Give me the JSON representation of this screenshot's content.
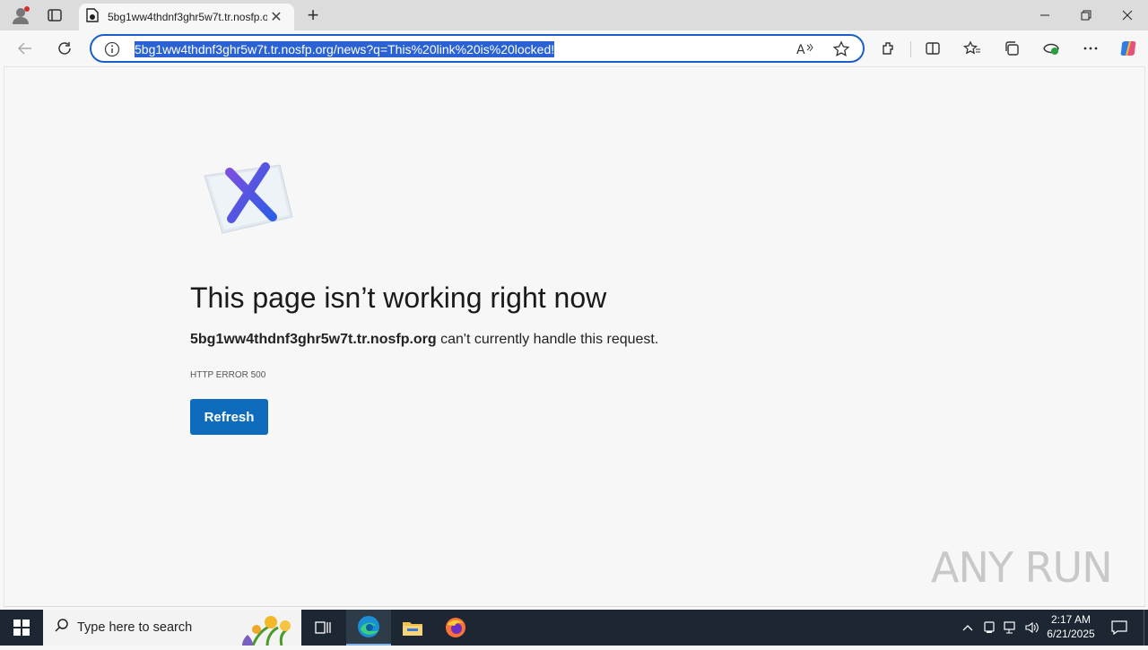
{
  "browser": {
    "tab_title": "5bg1ww4thdnf3ghr5w7t.tr.nosfp.org",
    "tab_close": "✕",
    "new_tab": "+",
    "url": "5bg1ww4thdnf3ghr5w7t.tr.nosfp.org/news?q=This%20link%20is%20locked!"
  },
  "error_page": {
    "heading": "This page isn’t working right now",
    "host": "5bg1ww4thdnf3ghr5w7t.tr.nosfp.org",
    "message_suffix": " can't currently handle this request.",
    "error_code": "HTTP ERROR 500",
    "refresh_label": "Refresh"
  },
  "watermark": "ANY RUN",
  "taskbar": {
    "search_placeholder": "Type here to search",
    "time": "2:17 AM",
    "date": "6/21/2025"
  },
  "colors": {
    "accent": "#0f6cbd",
    "address_border": "#1a5fc8",
    "selection": "#2a62d3",
    "taskbar": "#1c2733"
  }
}
